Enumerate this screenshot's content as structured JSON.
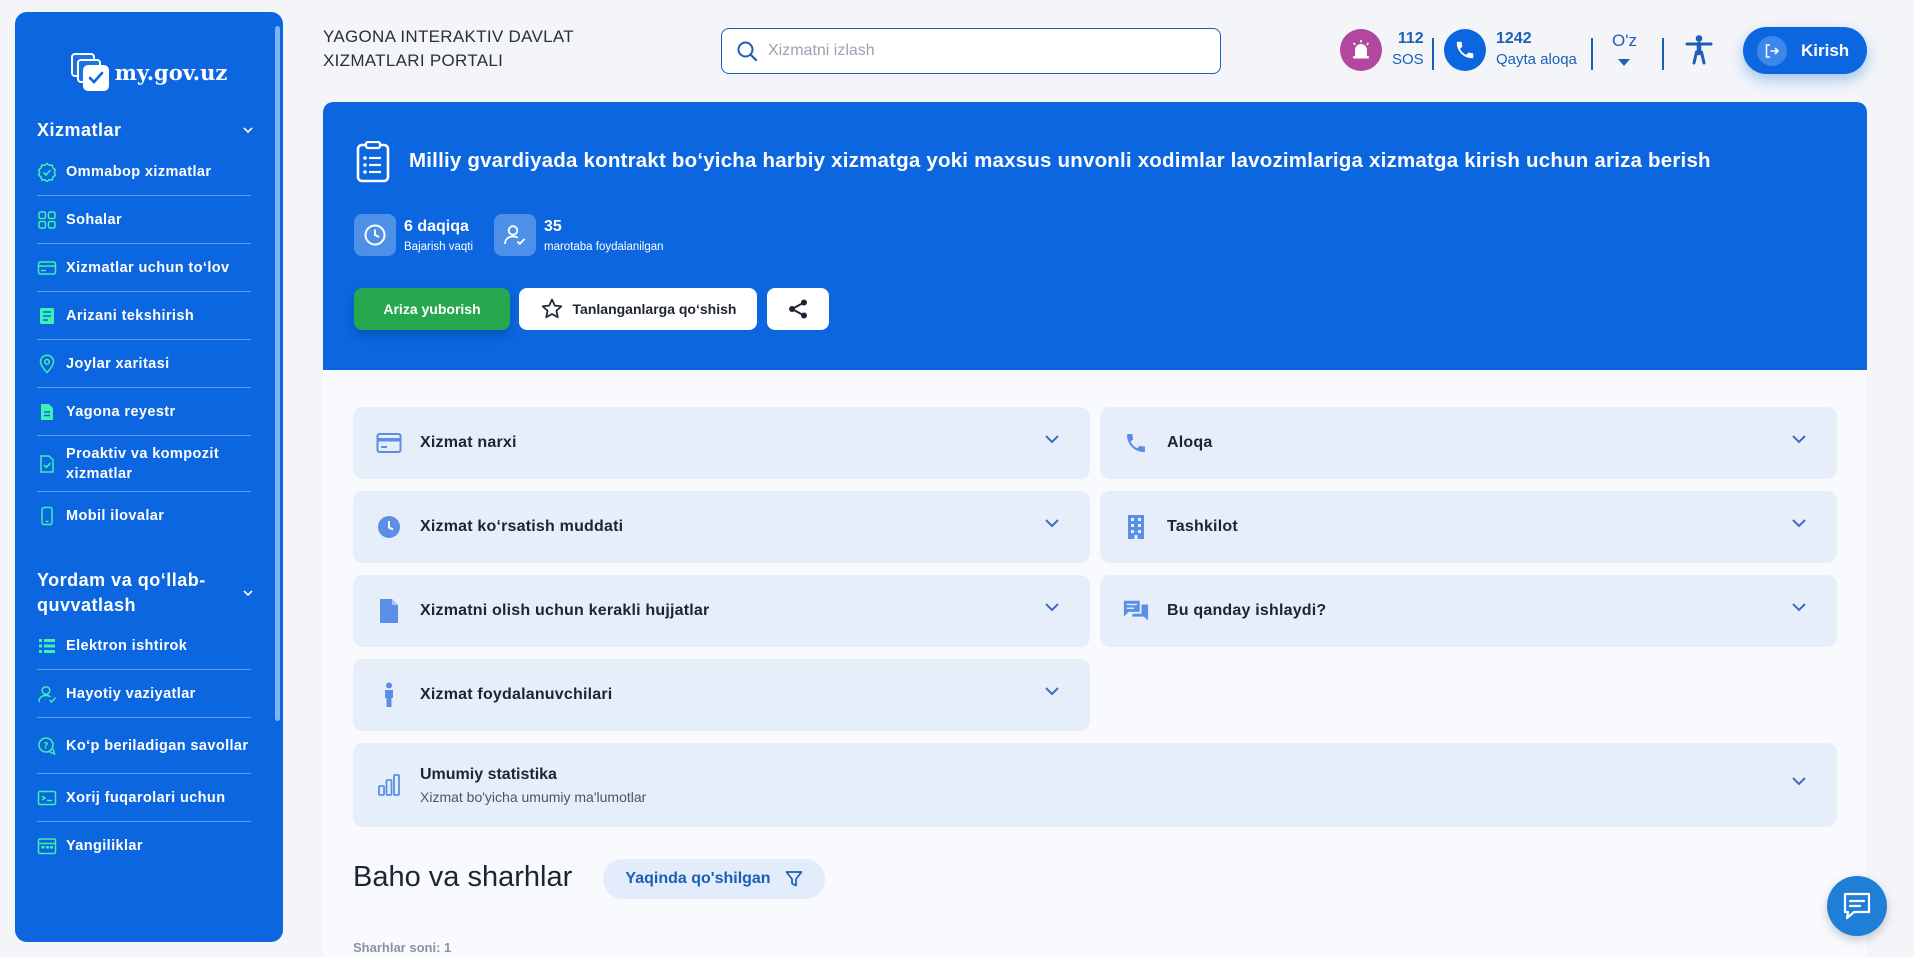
{
  "colors": {
    "brand_blue": "#0b66e0",
    "accent_green": "#27a84f",
    "sidebar_icon": "#3ff1b0",
    "sos_purple": "#b3479f"
  },
  "sidebar": {
    "logo_text": "my.gov.uz",
    "section1": {
      "title": "Xizmatlar",
      "items": [
        {
          "label": "Ommabop xizmatlar",
          "icon": "badge-check-icon"
        },
        {
          "label": "Sohalar",
          "icon": "grid-icon"
        },
        {
          "label": "Xizmatlar uchun to‘lov",
          "icon": "card-icon"
        },
        {
          "label": "Arizani tekshirish",
          "icon": "checklist-icon"
        },
        {
          "label": "Joylar xaritasi",
          "icon": "map-pin-icon"
        },
        {
          "label": "Yagona reyestr",
          "icon": "document-icon"
        },
        {
          "label": "Proaktiv va kompozit xizmatlar",
          "icon": "doc-check-icon"
        },
        {
          "label": "Mobil ilovalar",
          "icon": "phone-icon"
        }
      ]
    },
    "section2": {
      "title": "Yordam va qo‘llab-quvvatlash",
      "items": [
        {
          "label": "Elektron ishtirok",
          "icon": "list-icon"
        },
        {
          "label": "Hayotiy vaziyatlar",
          "icon": "user-icon"
        },
        {
          "label": "Ko‘p beriladigan savollar",
          "icon": "faq-icon"
        },
        {
          "label": "Xorij fuqarolari uchun",
          "icon": "id-card-icon"
        },
        {
          "label": "Yangiliklar",
          "icon": "calendar-icon"
        }
      ]
    }
  },
  "header": {
    "portal_title": "YAGONA INTERAKTIV DAVLAT XIZMATLARI PORTALI",
    "search_placeholder": "Xizmatni izlash",
    "sos_number": "112",
    "sos_label": "SOS",
    "callback_number": "1242",
    "callback_label": "Qayta aloqa",
    "language": "O'z",
    "login_label": "Kirish"
  },
  "service": {
    "title": "Milliy gvardiyada kontrakt bo‘yicha harbiy xizmatga yoki maxsus unvonli xodimlar lavozimlariga xizmatga kirish uchun ariza berish",
    "duration_value": "6 daqiqa",
    "duration_label": "Bajarish vaqti",
    "usage_value": "35",
    "usage_label": "marotaba foydalanilgan",
    "submit_label": "Ariza yuborish",
    "favorite_label": "Tanlanganlarga qo‘shish"
  },
  "accordions": {
    "price": "Xizmat narxi",
    "contact": "Aloqa",
    "duration": "Xizmat ko‘rsatish muddati",
    "organization": "Tashkilot",
    "documents": "Xizmatni olish uchun kerakli hujjatlar",
    "how_it_works": "Bu qanday ishlaydi?",
    "users": "Xizmat foydalanuvchilari",
    "statistics_title": "Umumiy statistika",
    "statistics_sub": "Xizmat bo'yicha umumiy ma'lumotlar"
  },
  "reviews": {
    "title": "Baho va sharhlar",
    "filter_label": "Yaqinda qo'shilgan",
    "count_label": "Sharhlar soni: 1"
  }
}
